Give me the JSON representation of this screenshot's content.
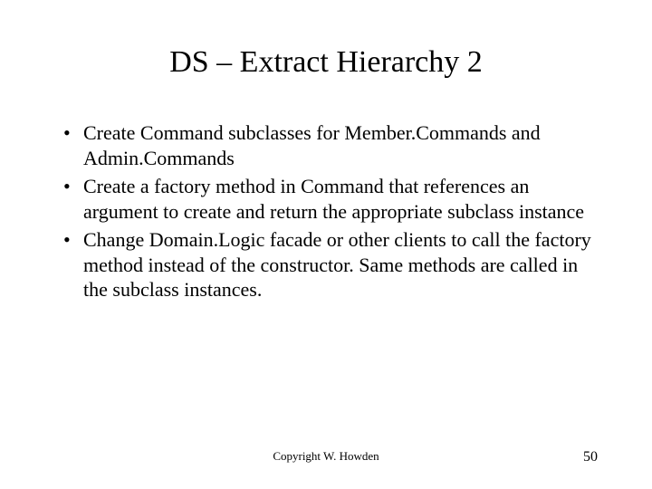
{
  "title": "DS – Extract Hierarchy 2",
  "bullets": {
    "b1": "Create Command subclasses for Member.Commands and Admin.Commands",
    "b2": "Create a factory method in Command that references an argument to create and return the appropriate subclass instance",
    "b3": "Change Domain.Logic facade or other clients to call the factory method instead of the constructor. Same methods are called in the subclass instances."
  },
  "footer": {
    "copyright": "Copyright W. Howden",
    "page": "50"
  }
}
